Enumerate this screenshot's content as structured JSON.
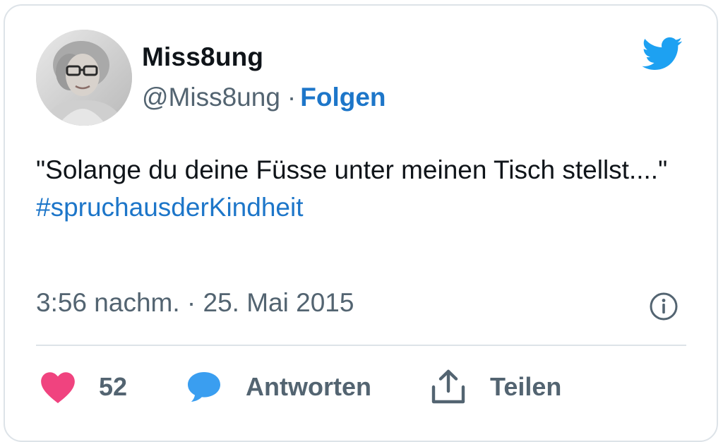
{
  "user": {
    "display_name": "Miss8ung",
    "handle": "@Miss8ung",
    "separator": "·",
    "follow_label": "Folgen"
  },
  "tweet": {
    "text": "\"Solange du deine Füsse unter meinen Tisch stellst....\"",
    "hashtag": "#spruchausderKindheit",
    "timestamp": "3:56 nachm. · 25. Mai 2015"
  },
  "actions": {
    "like_count": "52",
    "reply_label": "Antworten",
    "share_label": "Teilen"
  },
  "icons": {
    "brand": "twitter-bird-icon",
    "info": "info-icon",
    "like": "heart-icon",
    "reply": "speech-bubble-icon",
    "share": "share-upload-icon"
  },
  "colors": {
    "text_primary": "#0f1419",
    "text_secondary": "#536471",
    "link_blue": "#1d76c9",
    "twitter_blue": "#1da1f2",
    "like_pink": "#f0437f",
    "reply_blue": "#3a9ef0",
    "border": "#dde3e8"
  }
}
